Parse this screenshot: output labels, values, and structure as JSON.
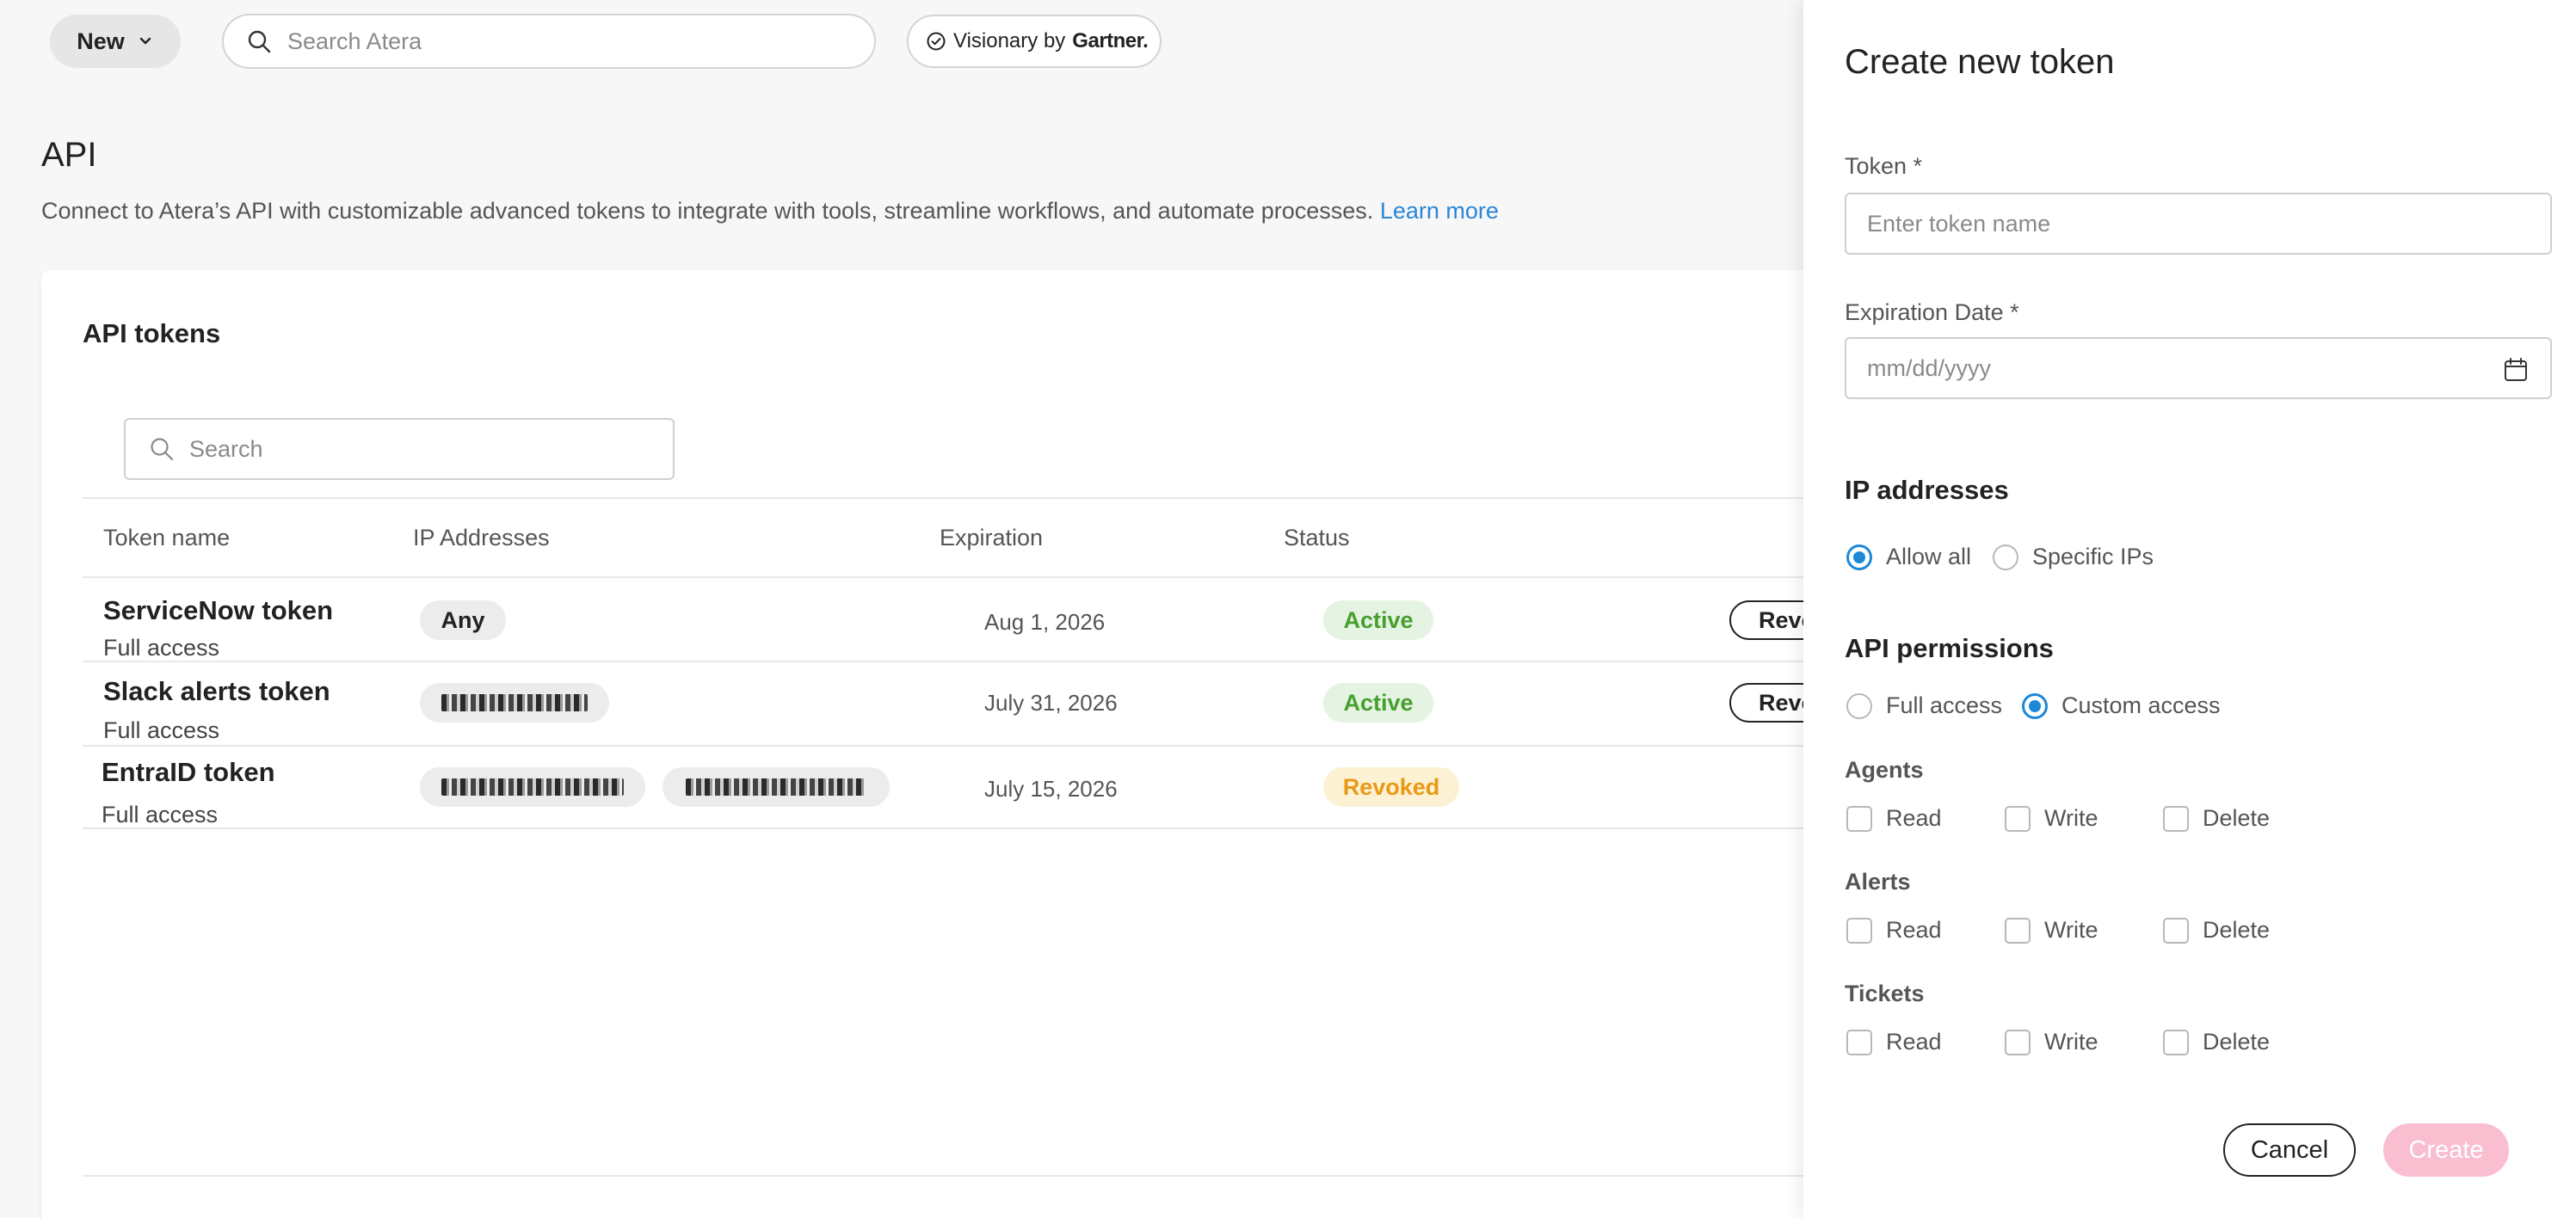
{
  "topbar": {
    "new_label": "New",
    "search_placeholder": "Search Atera",
    "gartner_prefix": "Visionary by",
    "gartner_brand": "Gartner."
  },
  "page": {
    "title": "API",
    "description": "Connect to Atera’s API with customizable advanced tokens to integrate with tools, streamline workflows, and automate processes.",
    "learn_more": "Learn more"
  },
  "card": {
    "title": "API tokens",
    "search_placeholder": "Search",
    "columns": [
      "Token name",
      "IP Addresses",
      "Expiration",
      "Status"
    ],
    "rows": [
      {
        "name": "ServiceNow token",
        "access": "Full access",
        "ips": [
          "Any"
        ],
        "expiration": "Aug 1, 2026",
        "status": "Active",
        "action": "Revoke"
      },
      {
        "name": "Slack alerts token",
        "access": "Full access",
        "ips": [
          "[redacted]"
        ],
        "expiration": "July 31, 2026",
        "status": "Active",
        "action": "Revoke"
      },
      {
        "name": "EntraID token",
        "access": "Full access",
        "ips": [
          "[redacted]",
          "[redacted]"
        ],
        "expiration": "July 15, 2026",
        "status": "Revoked",
        "action": ""
      }
    ]
  },
  "drawer": {
    "title": "Create new token",
    "token_label": "Token *",
    "token_placeholder": "Enter token name",
    "expiration_label": "Expiration Date *",
    "expiration_placeholder": "mm/dd/yyyy",
    "ip_section": "IP addresses",
    "ip_options": [
      "Allow all",
      "Specific IPs"
    ],
    "ip_selected": "Allow all",
    "perm_section": "API permissions",
    "perm_options": [
      "Full access",
      "Custom access"
    ],
    "perm_selected": "Custom access",
    "groups": [
      {
        "name": "Agents",
        "perms": [
          "Read",
          "Write",
          "Delete"
        ]
      },
      {
        "name": "Alerts",
        "perms": [
          "Read",
          "Write",
          "Delete"
        ]
      },
      {
        "name": "Tickets",
        "perms": [
          "Read",
          "Write",
          "Delete"
        ]
      }
    ],
    "cancel_label": "Cancel",
    "create_label": "Create"
  },
  "colors": {
    "accent": "#1e88d8",
    "link": "#2a86d6",
    "active_text": "#46a02f",
    "active_bg": "#e5f3e2",
    "revoked_text": "#e89a16",
    "revoked_bg": "#fdf1d4",
    "create_disabled": "#f9bfd1"
  },
  "icons": {
    "new_chevron": "chevron-down-icon",
    "search": "search-icon",
    "gartner": "check-circle-icon",
    "calendar": "calendar-icon"
  }
}
